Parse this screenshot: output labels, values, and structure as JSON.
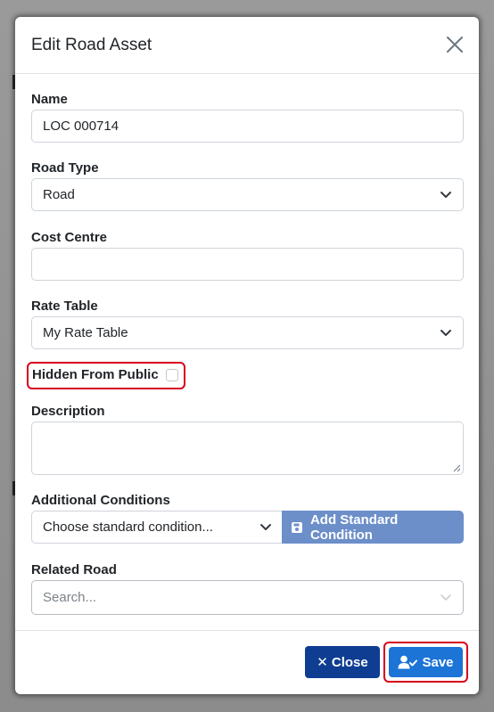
{
  "modal": {
    "title": "Edit Road Asset"
  },
  "fields": {
    "name": {
      "label": "Name",
      "value": "LOC 000714"
    },
    "road_type": {
      "label": "Road Type",
      "value": "Road"
    },
    "cost_centre": {
      "label": "Cost Centre",
      "value": ""
    },
    "rate_table": {
      "label": "Rate Table",
      "value": "My Rate Table"
    },
    "hidden_from_public": {
      "label": "Hidden From Public",
      "checked": false
    },
    "description": {
      "label": "Description",
      "value": ""
    },
    "additional_conditions": {
      "label": "Additional Conditions",
      "select_value": "Choose standard condition...",
      "add_button": "Add Standard Condition"
    },
    "related_road": {
      "label": "Related Road",
      "placeholder": "Search..."
    }
  },
  "footer": {
    "close_label": "Close",
    "save_label": "Save"
  },
  "colors": {
    "primary": "#1b74d6",
    "dark_primary": "#0f3d91",
    "muted_button": "#6c8fc9",
    "highlight": "#d6001c"
  },
  "icons": [
    "close-icon",
    "chevron-down-icon",
    "floppy-disk-icon",
    "times-icon",
    "user-check-icon"
  ]
}
